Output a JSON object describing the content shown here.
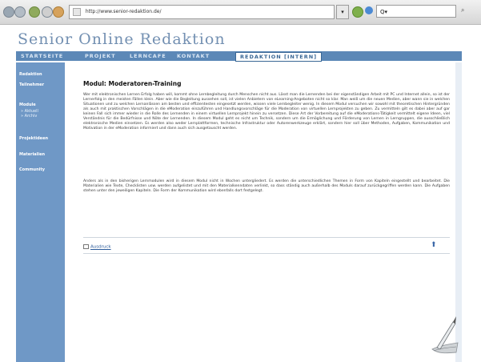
{
  "browser": {
    "url": "http://www.senior-redaktion.de/",
    "search_placeholder": "Q▾"
  },
  "site": {
    "title": "Senior Online Redaktion"
  },
  "nav": {
    "items": [
      "STARTSEITE",
      "PROJEKT",
      "LERNCAFE",
      "KONTAKT",
      "REDAKTION [INTERN]"
    ],
    "active": "REDAKTION [INTERN]"
  },
  "sidebar": {
    "items": [
      "Redaktion",
      "Teilnehmer",
      "Module",
      "Projektideen",
      "Materialien",
      "Community"
    ],
    "module_sub": [
      "» Aktuell",
      "» Archiv"
    ]
  },
  "article": {
    "title": "Modul: Moderatoren-Training",
    "paragraph1": "Wer mit elektronischen Lernen Erfolg haben will, kommt ohne Lernbegleitung durch Menschen nicht aus. Lässt man die Lernenden bei der eigenständigen Arbeit mit PC und Internet allein, so ist der Lernerfolg in den meisten Fällen klein. Aber wie die Begleitung aussehen soll, ist vielen Anbietern von eLearning-Angeboten nicht so klar. Man weiß um die neuen Medien, aber wann sie in welchen Situationen und zu welchen Lernanlässen am besten und effizientesten eingesetzt werden, wissen viele Lernbegleiter wenig. In diesem Modul versuchen wir sowohl mit theoretischen Hintergründen als auch mit praktischen Vorschlägen in die eModeration einzuführen und Handlungsvorschläge für die Moderation von virtuellen Lernprojekten zu geben. Zu vermitteln gilt es dabei aber auf gar keinen Fall sich immer wieder in die Rolle des Lernenden in einem virtuellen Lernprojekt hinein zu versetzen. Diese Art der Vorbereitung auf die eModerations-Tätigkeit vermittelt eigene Ideen, viel Verständnis für die Bedürfnisse und Nöte der Lernenden. In diesem Modul geht es nicht um Technik, sondern um die Ermöglichung und Förderung von Lernen in Lerngruppen, die ausschließlich elektronische Medien einsetzen. Es werden also weder Lernplattformen, technische Infrastruktur oder Autorenwerkzeuge erklärt, sondern hier soll über Methoden, Aufgaben, Kommunikation und Motivation in der eModeration informiert und dann auch sich ausgetauscht werden.",
    "paragraph2": "Anders als in den bisherigen Lernmodulen wird in diesem Modul nicht in Wochen untergliedert. Es werden die unterschiedlichen Themen in Form von Kapiteln eingestellt und bearbeitet. Die Materialien wie Texte, Checklisten usw. werden aufgelistet und mit den Materialkenndaten verlinkt, so dass ständig auch außerhalb des Moduls darauf zurückgegriffen werden kann. Die Aufgaben stehen unter den jeweiligen Kapiteln. Die Form der Kommunikation wird ebenfalls dort festgelegt.",
    "print_label": "Ausdruck",
    "top_glyph": "⬆"
  },
  "colors": {
    "nav_bar": "#5c88b7",
    "sidebar": "#6f98c6",
    "title": "#7390b2"
  }
}
